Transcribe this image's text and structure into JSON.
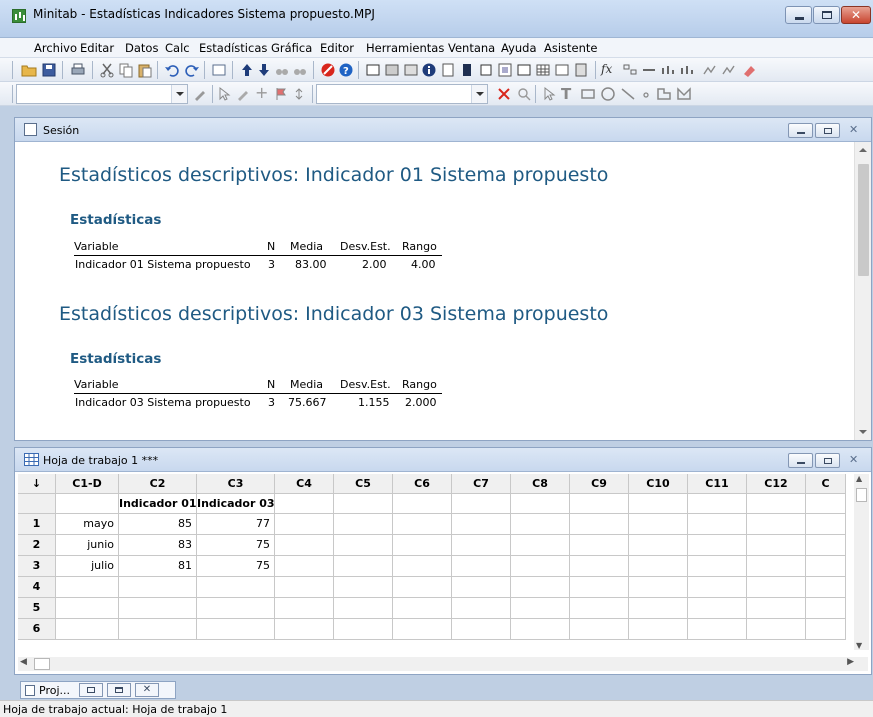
{
  "window": {
    "title": "Minitab - Estadísticas Indicadores Sistema propuesto.MPJ"
  },
  "menu": [
    "Archivo",
    "Editar",
    "Datos",
    "Calc",
    "Estadísticas",
    "Gráfica",
    "Editor",
    "Herramientas",
    "Ventana",
    "Ayuda",
    "Asistente"
  ],
  "session": {
    "title": "Sesión",
    "blocks": [
      {
        "heading": "Estadísticos descriptivos: Indicador 01 Sistema propuesto",
        "subheading": "Estadísticas",
        "columns": [
          "Variable",
          "N",
          "Media",
          "Desv.Est.",
          "Rango"
        ],
        "row": [
          "Indicador 01 Sistema propuesto",
          "3",
          "83.00",
          "2.00",
          "4.00"
        ]
      },
      {
        "heading": "Estadísticos descriptivos: Indicador 03 Sistema propuesto",
        "subheading": "Estadísticas",
        "columns": [
          "Variable",
          "N",
          "Media",
          "Desv.Est.",
          "Rango"
        ],
        "row": [
          "Indicador 03 Sistema propuesto",
          "3",
          "75.667",
          "1.155",
          "2.000"
        ]
      }
    ]
  },
  "worksheet": {
    "title": "Hoja de trabajo 1 ***",
    "corner": "↓",
    "columns": [
      "C1-D",
      "C2",
      "C3",
      "C4",
      "C5",
      "C6",
      "C7",
      "C8",
      "C9",
      "C10",
      "C11",
      "C12",
      "C"
    ],
    "column_names": [
      "",
      "Indicador 01",
      "Indicador 03",
      "",
      "",
      "",
      "",
      "",
      "",
      "",
      "",
      "",
      ""
    ],
    "row_numbers": [
      "1",
      "2",
      "3",
      "4",
      "5",
      "6"
    ],
    "rows": [
      [
        "mayo",
        "85",
        "77"
      ],
      [
        "junio",
        "83",
        "75"
      ],
      [
        "julio",
        "81",
        "75"
      ],
      [
        "",
        "",
        ""
      ],
      [
        "",
        "",
        ""
      ],
      [
        "",
        "",
        ""
      ]
    ]
  },
  "taskbar": {
    "project_label": "Proj..."
  },
  "status": {
    "text": "Hoja de trabajo actual: Hoja de trabajo 1"
  }
}
